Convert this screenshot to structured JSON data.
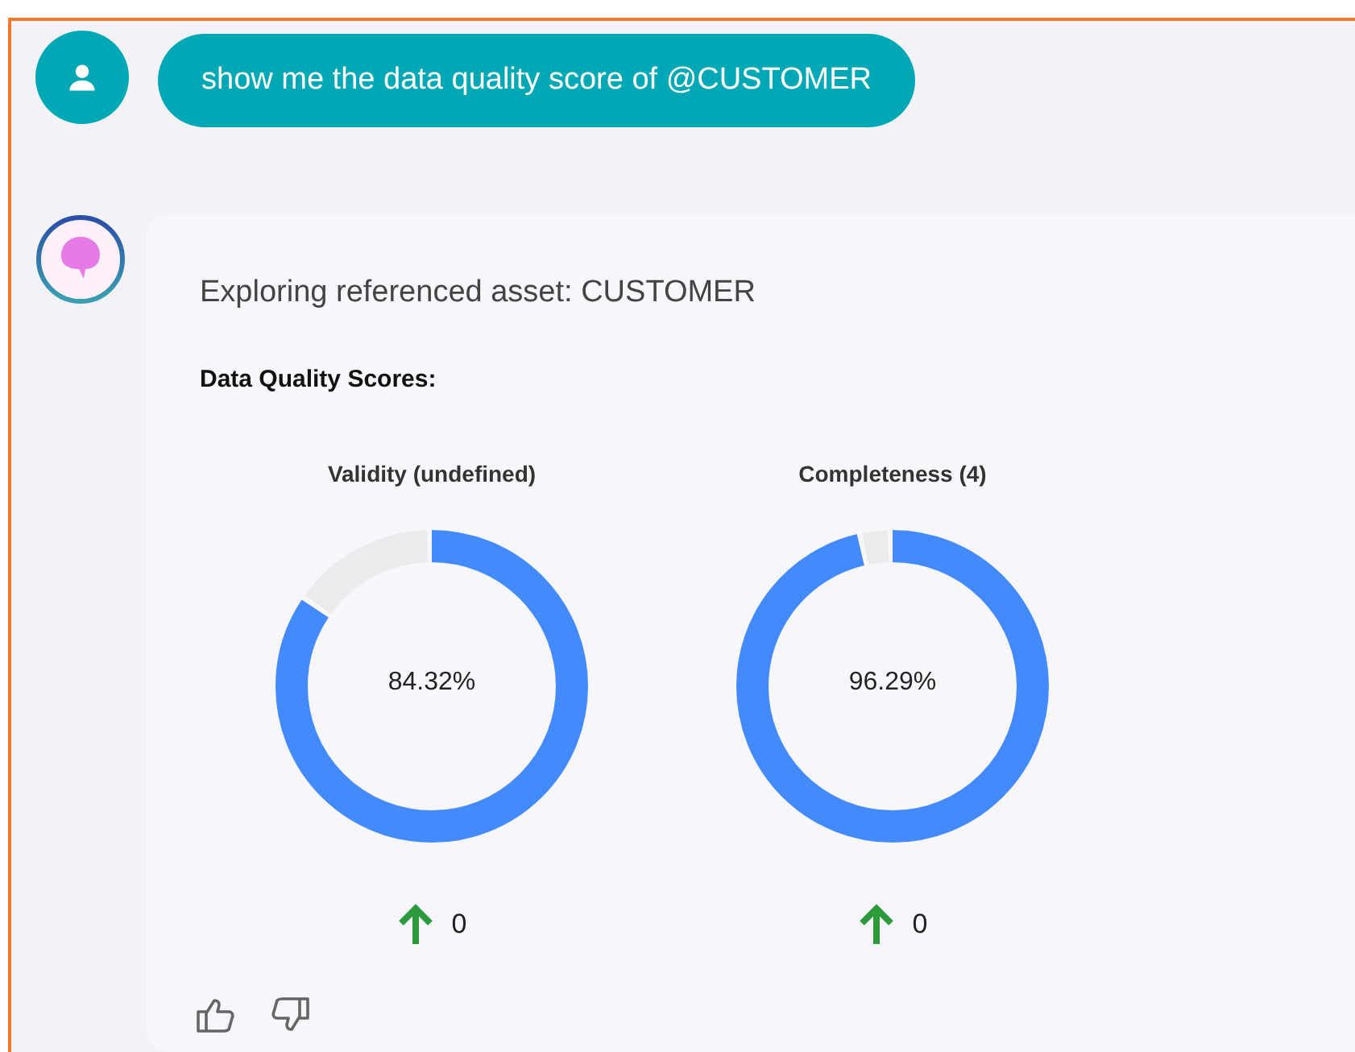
{
  "user_message": {
    "text": "show me the data quality score of @CUSTOMER"
  },
  "response": {
    "intro": "Exploring referenced asset: CUSTOMER",
    "heading": "Data Quality Scores:",
    "scores": [
      {
        "label": "Validity (undefined)",
        "level": 0.8432,
        "value": "84.32%",
        "change": "0"
      },
      {
        "label": "Completeness (4)",
        "level": 0.9629,
        "value": "96.29%",
        "change": "0"
      }
    ]
  }
}
